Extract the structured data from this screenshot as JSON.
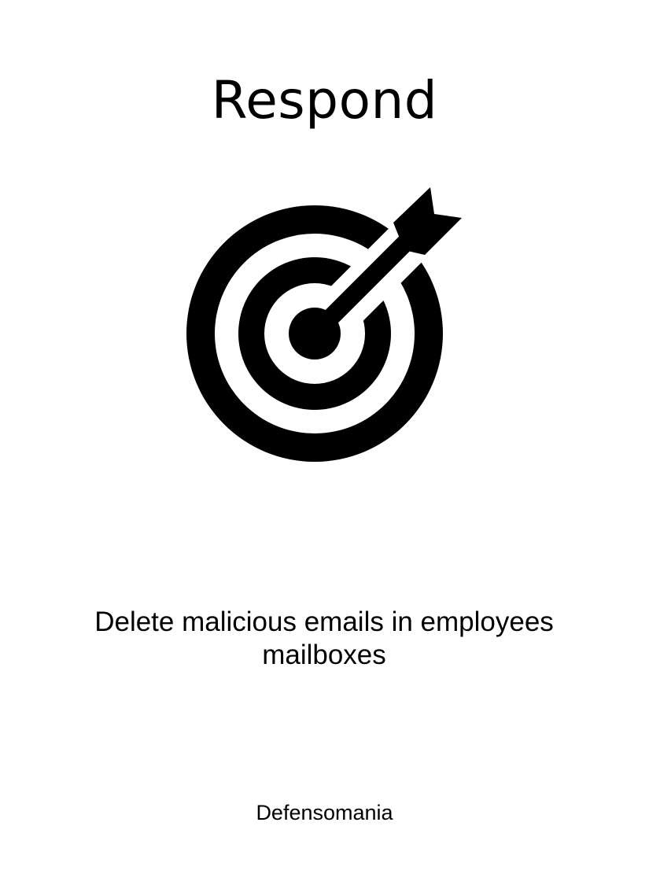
{
  "card": {
    "title": "Respond",
    "icon": "target-with-arrow-icon",
    "description": "Delete malicious emails in employees mailboxes",
    "brand": "Defensomania"
  },
  "colors": {
    "background": "#ffffff",
    "foreground": "#000000"
  }
}
